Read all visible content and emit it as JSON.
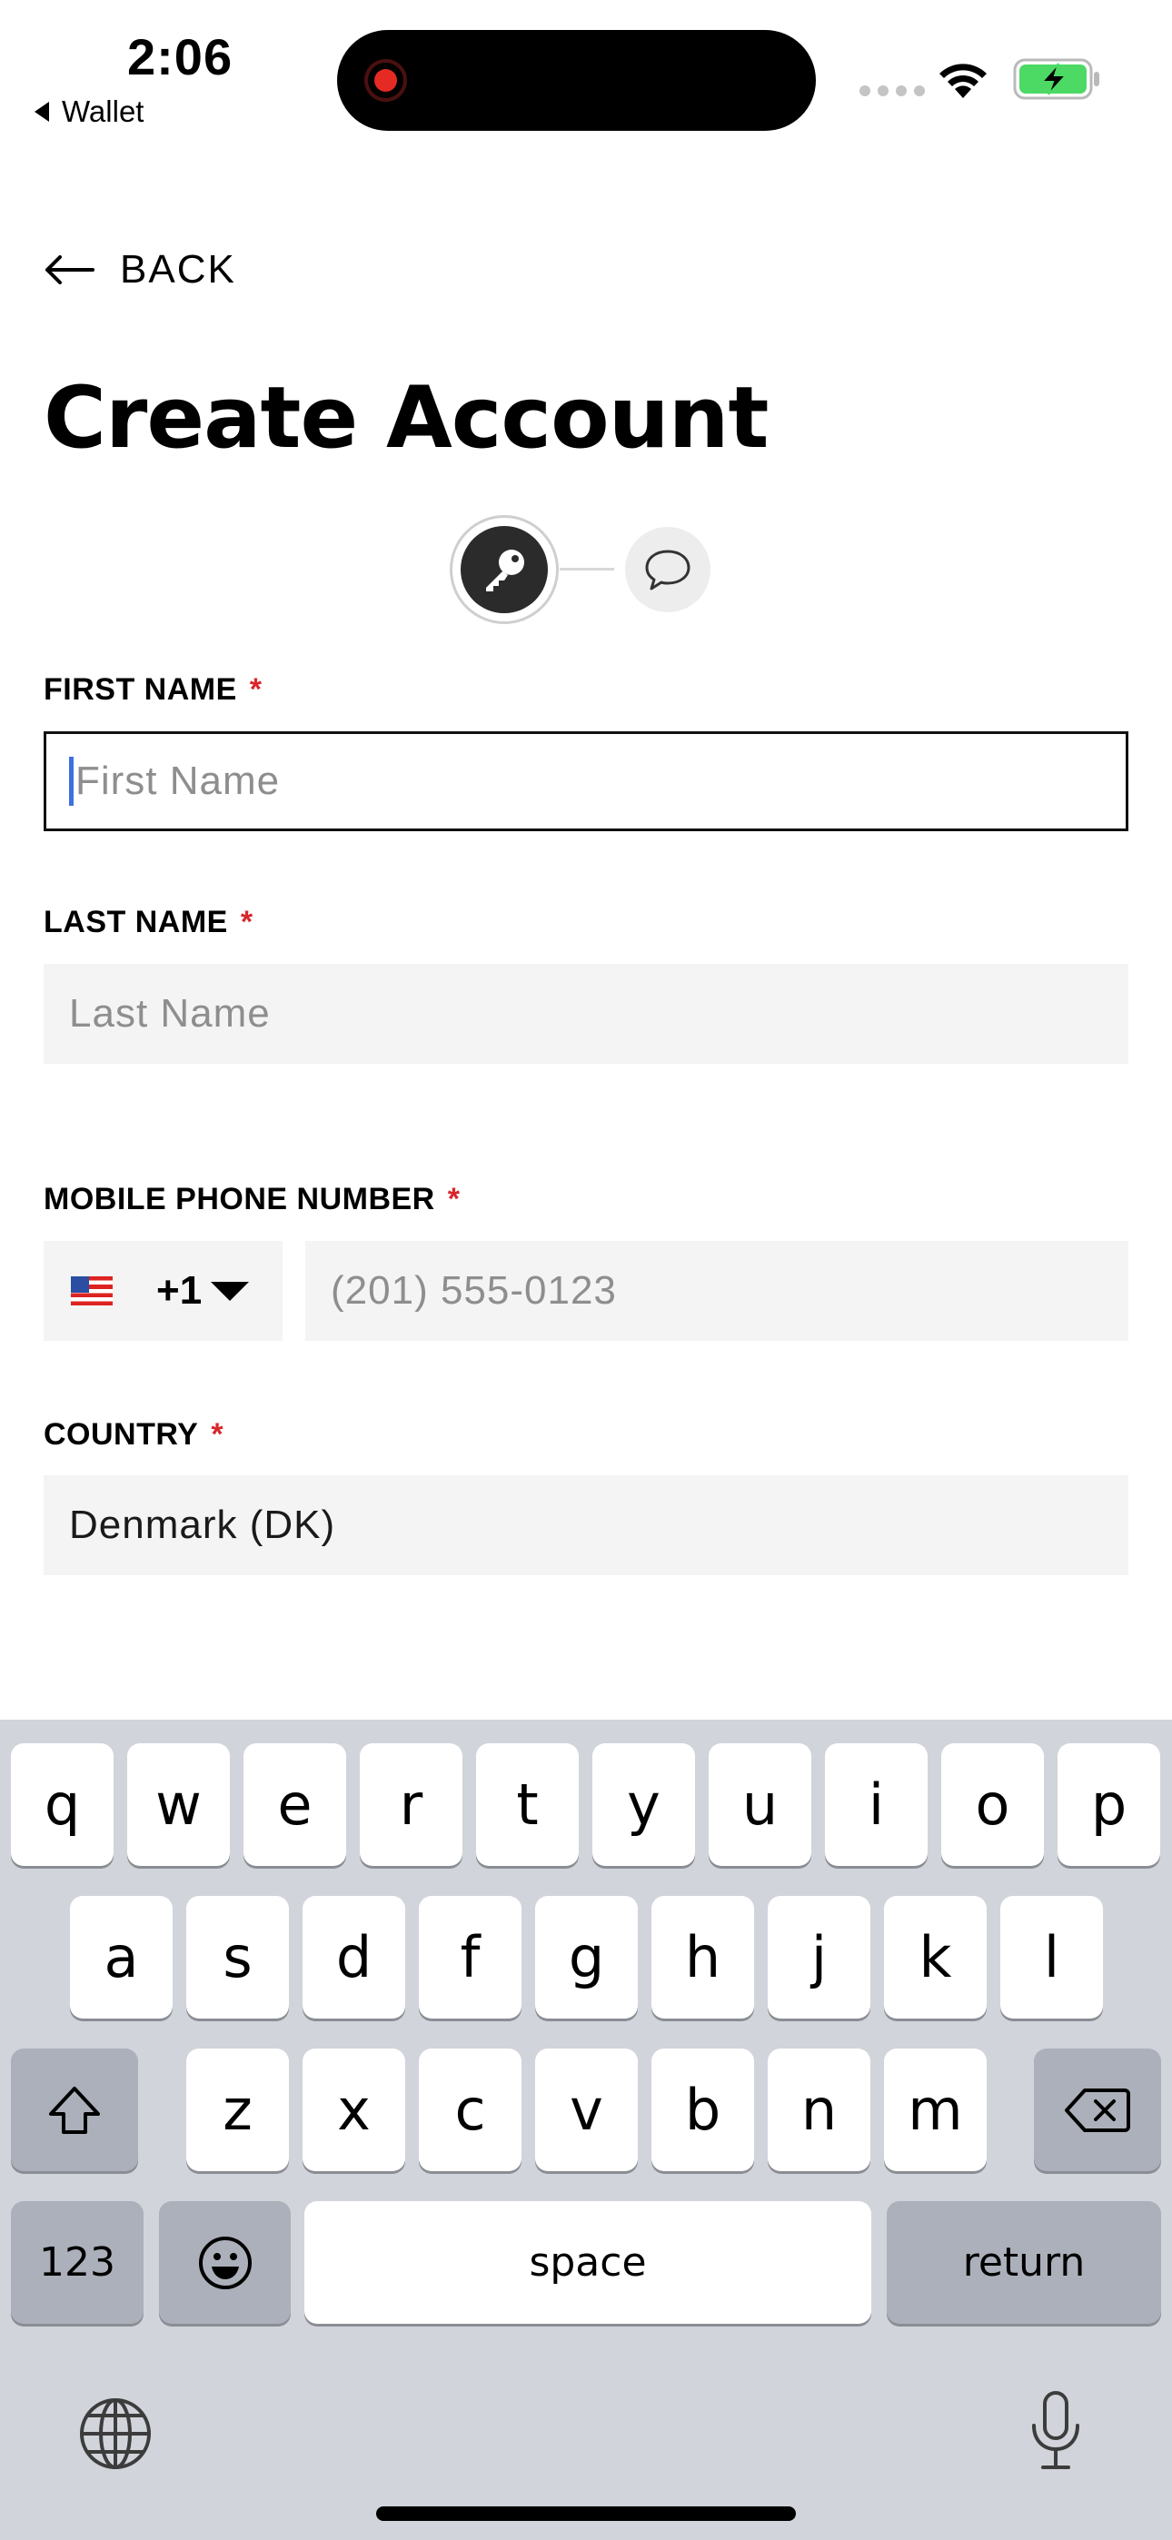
{
  "status_bar": {
    "time": "2:06",
    "back_app": "Wallet",
    "battery_color": "#4cd964"
  },
  "nav": {
    "back_label": "BACK"
  },
  "page": {
    "title": "Create Account"
  },
  "stepper": {
    "steps": [
      "key-icon",
      "chat-bubble-icon"
    ],
    "current_step": 1
  },
  "form": {
    "first_name": {
      "label": "FIRST NAME",
      "required": "*",
      "placeholder": "First Name",
      "value": ""
    },
    "last_name": {
      "label": "LAST NAME",
      "required": "*",
      "placeholder": "Last Name",
      "value": ""
    },
    "phone": {
      "label": "MOBILE PHONE NUMBER",
      "required": "*",
      "country_code": "+1",
      "flag": "us-flag-icon",
      "placeholder": "(201) 555-0123",
      "value": ""
    },
    "country": {
      "label": "COUNTRY",
      "required": "*",
      "value": "Denmark (DK)"
    }
  },
  "keyboard": {
    "row1": [
      "q",
      "w",
      "e",
      "r",
      "t",
      "y",
      "u",
      "i",
      "o",
      "p"
    ],
    "row2": [
      "a",
      "s",
      "d",
      "f",
      "g",
      "h",
      "j",
      "k",
      "l"
    ],
    "row3": [
      "z",
      "x",
      "c",
      "v",
      "b",
      "n",
      "m"
    ],
    "numbers_key": "123",
    "space_key": "space",
    "return_key": "return"
  },
  "colors": {
    "required": "#d8262b",
    "field_bg": "#f4f4f4",
    "cursor": "#3d6fe0",
    "keyboard_bg": "#d1d4da"
  }
}
